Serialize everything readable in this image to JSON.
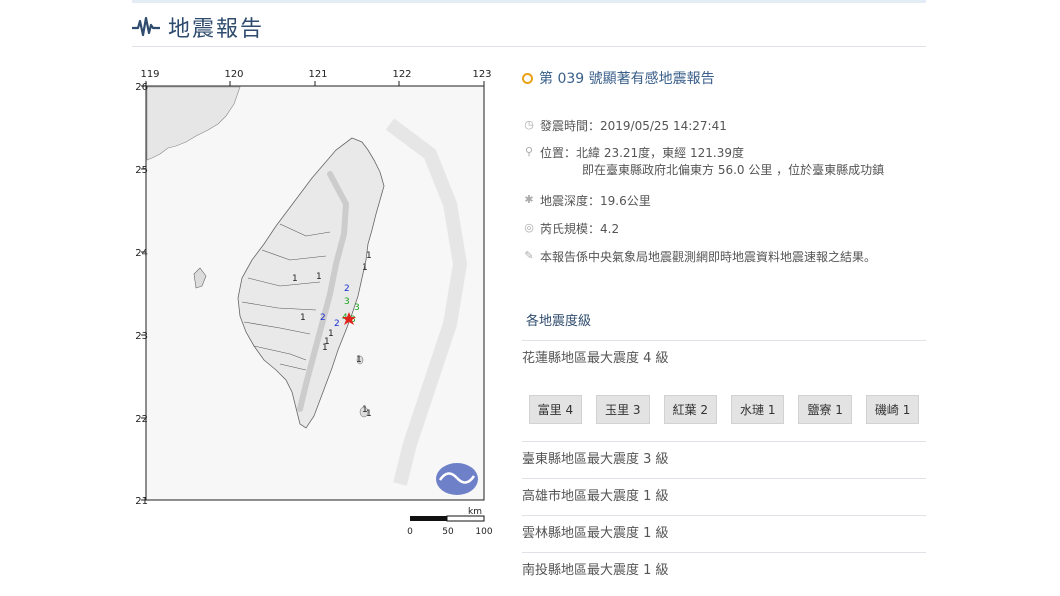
{
  "header": {
    "title": "地震報告"
  },
  "map": {
    "lon_ticks": [
      "119",
      "120",
      "121",
      "122",
      "123"
    ],
    "lat_ticks": [
      "26",
      "25",
      "24",
      "23",
      "22",
      "21"
    ],
    "scale_labels": [
      "0",
      "50",
      "100"
    ],
    "scale_unit": "km",
    "intensity_marks": [
      {
        "label": "1",
        "color": "#222"
      },
      {
        "label": "1",
        "color": "#222"
      },
      {
        "label": "1",
        "color": "#222"
      },
      {
        "label": "1",
        "color": "#222"
      },
      {
        "label": "1",
        "color": "#222"
      },
      {
        "label": "1",
        "color": "#222"
      },
      {
        "label": "1",
        "color": "#222"
      },
      {
        "label": "1",
        "color": "#222"
      },
      {
        "label": "1",
        "color": "#222"
      },
      {
        "label": "2",
        "color": "#1a2fd0"
      },
      {
        "label": "2",
        "color": "#1a2fd0"
      },
      {
        "label": "2",
        "color": "#1a2fd0"
      },
      {
        "label": "3",
        "color": "#19a21a"
      },
      {
        "label": "3",
        "color": "#19a21a"
      },
      {
        "label": "4",
        "color": "#19a21a"
      },
      {
        "label": "3",
        "color": "#19a21a"
      },
      {
        "label": "1",
        "color": "#222"
      },
      {
        "label": "1",
        "color": "#222"
      }
    ],
    "epicenter_color": "#e0241b"
  },
  "report": {
    "title": "第 039 號顯著有感地震報告",
    "time": "發震時間：2019/05/25 14:27:41",
    "location_line1": "位置：北緯 23.21度，東經 121.39度",
    "location_line2": "即在臺東縣政府北偏東方 56.0 公里 ，位於臺東縣成功鎮",
    "depth": "地震深度：19.6公里",
    "magnitude": "芮氏規模：4.2",
    "note": "本報告係中央氣象局地震觀測網即時地震資料地震速報之結果。"
  },
  "intensity": {
    "section_title": "各地震度級",
    "regions": [
      "花蓮縣地區最大震度 4 級",
      "臺東縣地區最大震度 3 級",
      "高雄市地區最大震度 1 級",
      "雲林縣地區最大震度 1 級",
      "南投縣地區最大震度 1 級"
    ],
    "stations": [
      "富里 4",
      "玉里 3",
      "紅葉 2",
      "水璉 1",
      "鹽寮 1",
      "磯崎 1"
    ]
  },
  "colors": {
    "accent": "#2f4c6e",
    "dot": "#e8a317"
  }
}
